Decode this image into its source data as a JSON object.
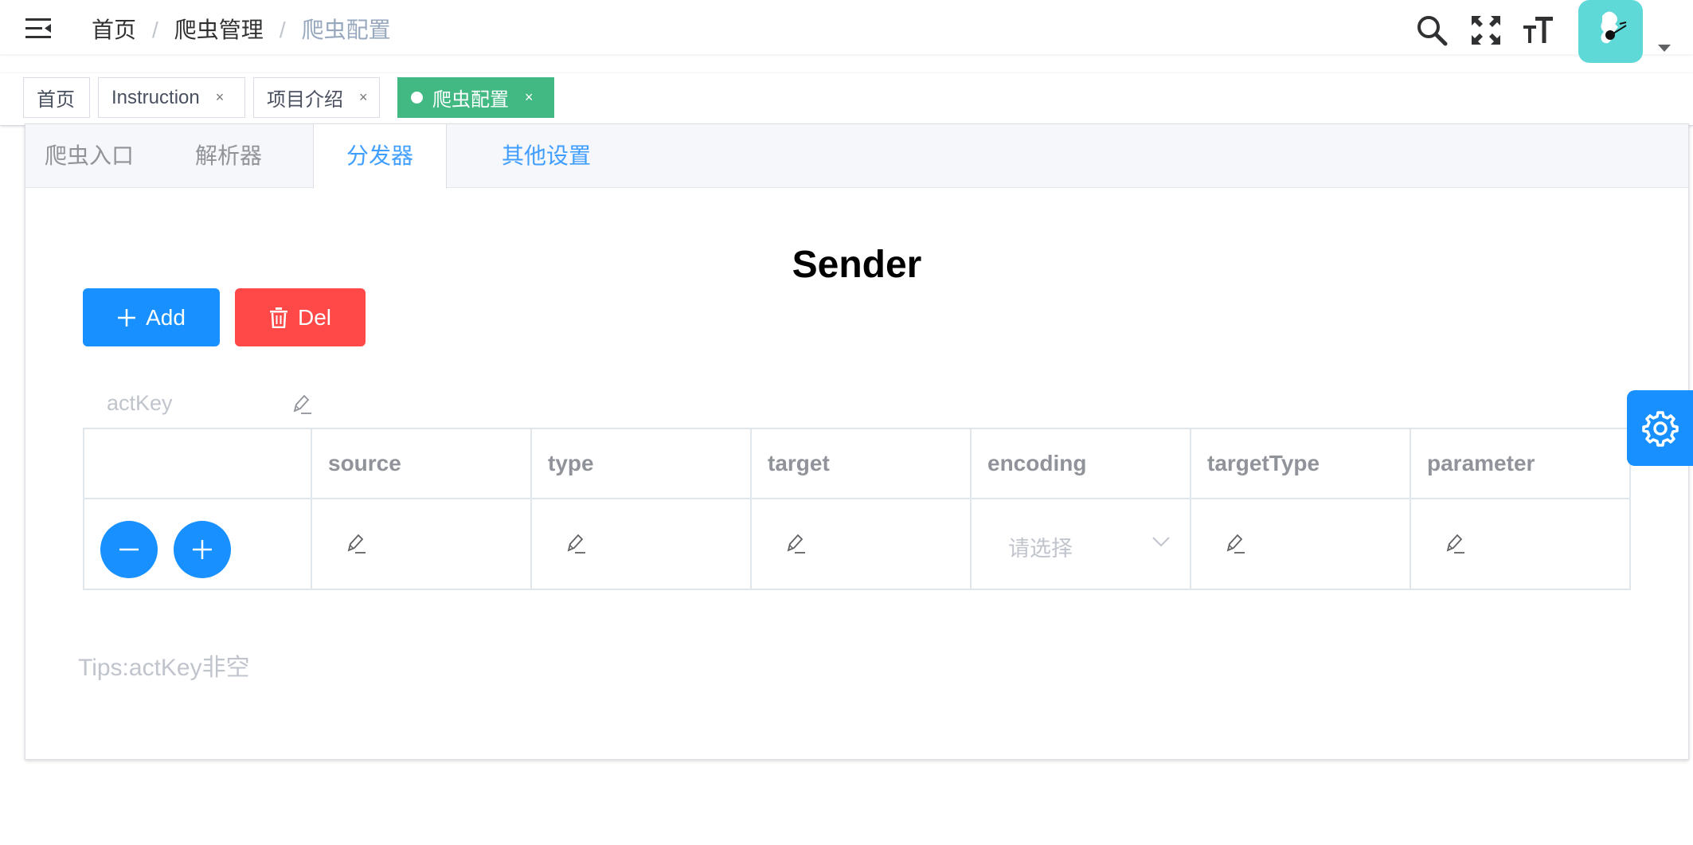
{
  "breadcrumb": {
    "items": [
      "首页",
      "爬虫管理",
      "爬虫配置"
    ],
    "separator": "/"
  },
  "icons": {
    "hamburger": "hamburger-icon",
    "search": "search-icon",
    "fullscreen": "fullscreen-icon",
    "size": "font-size-icon",
    "settings": "gear-icon"
  },
  "tags": [
    {
      "label": "首页"
    },
    {
      "label": "Instruction",
      "close": "×"
    },
    {
      "label": "项目介绍",
      "close": "×"
    },
    {
      "label": "爬虫配置",
      "close": "×",
      "active": true
    }
  ],
  "tabs": [
    {
      "label": "爬虫入口"
    },
    {
      "label": "解析器"
    },
    {
      "label": "分发器",
      "active": true
    },
    {
      "label": "其他设置"
    }
  ],
  "sender": {
    "title": "Sender",
    "add_label": "Add",
    "del_label": "Del",
    "actkey_placeholder": "actKey",
    "columns": [
      "",
      "source",
      "type",
      "target",
      "encoding",
      "targetType",
      "parameter"
    ],
    "encoding_placeholder": "请选择",
    "tips": "Tips:actKey非空"
  },
  "colors": {
    "primary": "#1890ff",
    "danger": "#ff4949",
    "tag_active": "#42b983",
    "avatar_bg": "#5fd8d8"
  }
}
